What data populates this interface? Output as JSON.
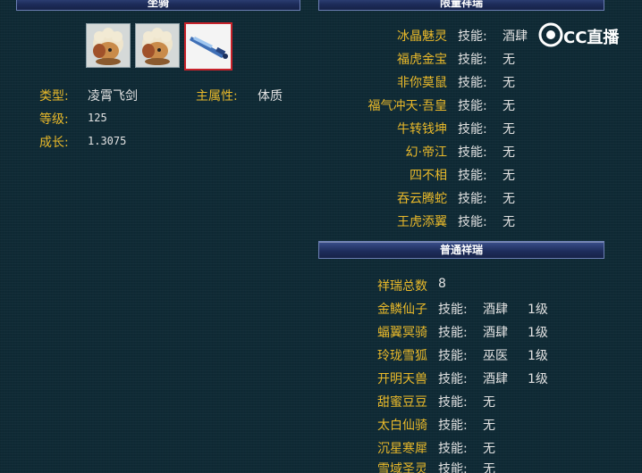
{
  "left": {
    "header": "坐骑",
    "rows": [
      {
        "label": "类型:",
        "value": "凌霄飞剑"
      },
      {
        "label": "等级:",
        "value": "125"
      },
      {
        "label": "成长:",
        "value": "1.3075"
      }
    ],
    "main_attr_label": "主属性:",
    "main_attr_value": "体质"
  },
  "limited": {
    "header": "限量祥瑞",
    "skill_label": "技能:",
    "items": [
      {
        "name": "冰晶魅灵",
        "skill": "酒肆"
      },
      {
        "name": "福虎金宝",
        "skill": "无"
      },
      {
        "name": "非你莫鼠",
        "skill": "无"
      },
      {
        "name": "福气冲天·吾皇",
        "skill": "无"
      },
      {
        "name": "牛转钱坤",
        "skill": "无"
      },
      {
        "name": "幻·帝江",
        "skill": "无"
      },
      {
        "name": "四不相",
        "skill": "无"
      },
      {
        "name": "吞云腾蛇",
        "skill": "无"
      },
      {
        "name": "王虎添翼",
        "skill": "无"
      }
    ]
  },
  "normal": {
    "header": "普通祥瑞",
    "total_label": "祥瑞总数",
    "total_value": "8",
    "skill_label": "技能:",
    "items": [
      {
        "name": "金鳞仙子",
        "skill": "酒肆",
        "level": "1级"
      },
      {
        "name": "蝠翼冥骑",
        "skill": "酒肆",
        "level": "1级"
      },
      {
        "name": "玲珑雪狐",
        "skill": "巫医",
        "level": "1级"
      },
      {
        "name": "开明天兽",
        "skill": "酒肆",
        "level": "1级"
      },
      {
        "name": "甜蜜豆豆",
        "skill": "无",
        "level": ""
      },
      {
        "name": "太白仙骑",
        "skill": "无",
        "level": ""
      },
      {
        "name": "沉星寒犀",
        "skill": "无",
        "level": ""
      },
      {
        "name": "雪域圣灵",
        "skill": "无",
        "level": ""
      }
    ]
  },
  "watermark": "CC直播"
}
